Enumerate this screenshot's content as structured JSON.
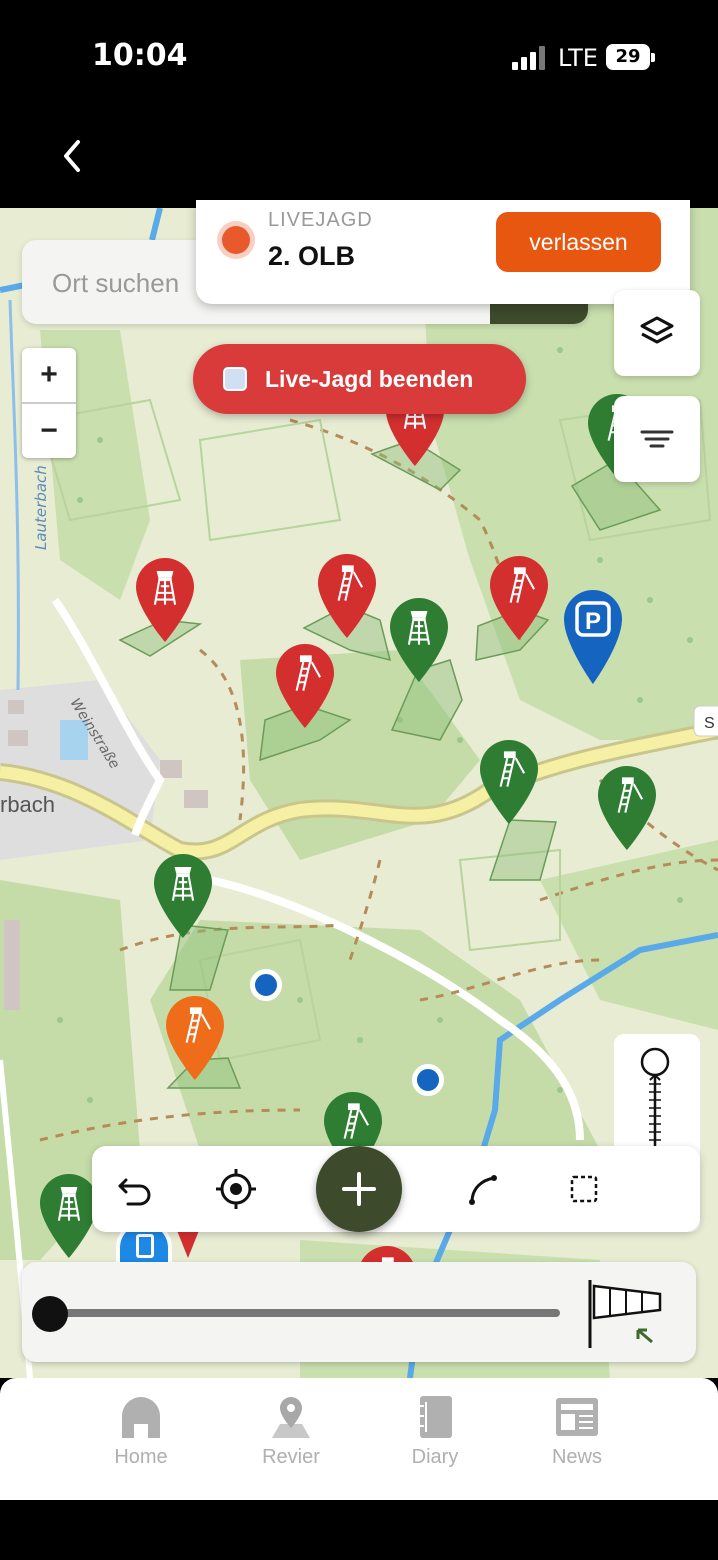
{
  "status_bar": {
    "time": "10:04",
    "network": "LTE",
    "battery": "29"
  },
  "search": {
    "placeholder": "Ort suchen"
  },
  "live_hunt": {
    "label": "LIVEJAGD",
    "name": "2. OLB",
    "leave_button": "verlassen"
  },
  "end_button": {
    "label": "Live-Jagd beenden"
  },
  "map_labels": {
    "stream": "Lauterbach",
    "street": "Weinstraße",
    "village": "rbach",
    "road_edge": "S"
  },
  "zoom": {
    "in": "+",
    "out": "−"
  },
  "toolbar": {
    "icons": [
      "undo-icon",
      "locate-icon",
      "add-icon",
      "curve-icon",
      "select-rectangle-icon"
    ]
  },
  "tabs": [
    {
      "label": "Home",
      "icon": "home-icon"
    },
    {
      "label": "Revier",
      "icon": "map-pin-icon"
    },
    {
      "label": "Diary",
      "icon": "diary-icon"
    },
    {
      "label": "News",
      "icon": "news-icon"
    }
  ],
  "colors": {
    "red_pin": "#d32f2f",
    "green_pin": "#2e7d32",
    "orange_pin": "#ef6c1a",
    "blue_pin": "#1565c0",
    "accent": "#e8570f",
    "end_button": "#d93a3a",
    "dark_green": "#3d4a2c"
  },
  "timeline": {
    "position": 0
  }
}
